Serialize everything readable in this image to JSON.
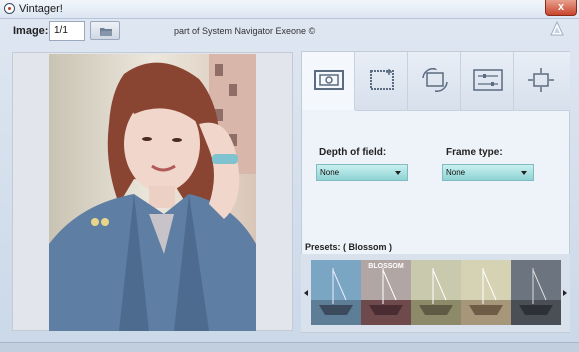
{
  "window": {
    "title": "Vintager!",
    "close_label": "x"
  },
  "toolbar": {
    "image_label": "Image:",
    "image_index": "1/1",
    "credit": "part of System Navigator Exeone ©"
  },
  "tabs": [
    {
      "name": "frame-tab",
      "icon": "frame-icon",
      "active": true
    },
    {
      "name": "crop-tab",
      "icon": "crop-icon",
      "active": false
    },
    {
      "name": "rotate-tab",
      "icon": "rotate-icon",
      "active": false
    },
    {
      "name": "adjust-tab",
      "icon": "sliders-icon",
      "active": false
    },
    {
      "name": "resize-tab",
      "icon": "resize-icon",
      "active": false
    }
  ],
  "settings": {
    "depth_label": "Depth of field:",
    "depth_value": "None",
    "frame_label": "Frame type:",
    "frame_value": "None"
  },
  "presets": {
    "label": "Presets: ( Blossom )",
    "items": [
      {
        "name": "preset-1",
        "caption": ""
      },
      {
        "name": "preset-blossom",
        "caption": "BLOSSOM"
      },
      {
        "name": "preset-3",
        "caption": ""
      },
      {
        "name": "preset-4",
        "caption": ""
      },
      {
        "name": "preset-5",
        "caption": ""
      }
    ]
  },
  "colors": {
    "accent_dropdown": "#9fdcdc",
    "close": "#c8452c"
  }
}
